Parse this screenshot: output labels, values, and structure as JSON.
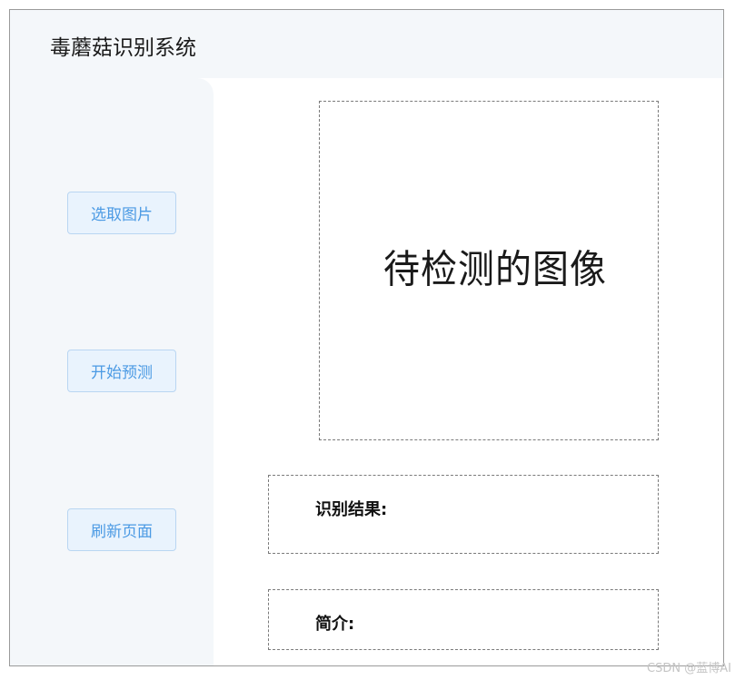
{
  "header": {
    "title": "毒蘑菇识别系统"
  },
  "sidebar": {
    "buttons": [
      {
        "label": "选取图片"
      },
      {
        "label": "开始预测"
      },
      {
        "label": "刷新页面"
      }
    ]
  },
  "main": {
    "image_placeholder": "待检测的图像",
    "result_label": "识别结果:",
    "intro_label": "简介:"
  },
  "watermark": "CSDN @蓝博AI",
  "colors": {
    "header_bg": "#f4f7fa",
    "sidebar_bg": "#f4f7fa",
    "button_bg": "#e9f3fd",
    "button_border": "#b9d6f2",
    "button_text": "#4b9ae4"
  }
}
